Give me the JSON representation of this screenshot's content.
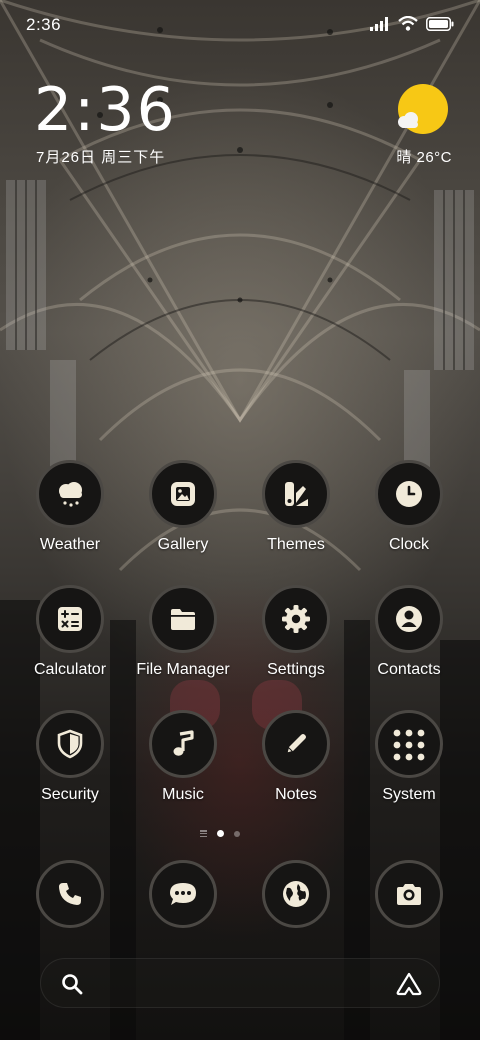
{
  "status_bar": {
    "time": "2:36",
    "icons": [
      "signal-icon",
      "wifi-icon",
      "battery-icon"
    ]
  },
  "clock_widget": {
    "time": "2:36",
    "date": "7月26日 周三下午"
  },
  "weather_widget": {
    "condition_icon": "sun-cloud-icon",
    "temperature": "晴 26°C"
  },
  "apps": [
    {
      "label": "Weather",
      "icon": "weather-icon"
    },
    {
      "label": "Gallery",
      "icon": "gallery-icon"
    },
    {
      "label": "Themes",
      "icon": "themes-icon"
    },
    {
      "label": "Clock",
      "icon": "clock-icon"
    },
    {
      "label": "Calculator",
      "icon": "calculator-icon"
    },
    {
      "label": "File Manager",
      "icon": "folder-icon"
    },
    {
      "label": "Settings",
      "icon": "gear-icon"
    },
    {
      "label": "Contacts",
      "icon": "contacts-icon"
    },
    {
      "label": "Security",
      "icon": "shield-icon"
    },
    {
      "label": "Music",
      "icon": "music-note-icon"
    },
    {
      "label": "Notes",
      "icon": "pencil-icon"
    },
    {
      "label": "System",
      "icon": "system-folder-icon"
    }
  ],
  "page_indicator": {
    "pages": 2,
    "active_page": 1
  },
  "dock": [
    {
      "icon": "phone-icon"
    },
    {
      "icon": "message-icon"
    },
    {
      "icon": "browser-globe-icon"
    },
    {
      "icon": "camera-icon"
    }
  ],
  "search_bar": {
    "left_icon": "search-icon",
    "right_icon": "assistant-icon"
  },
  "colors": {
    "icon_fill": "#f1ead9",
    "icon_bg": "#161514",
    "icon_border": "#4b4844",
    "sun": "#f7c815"
  }
}
